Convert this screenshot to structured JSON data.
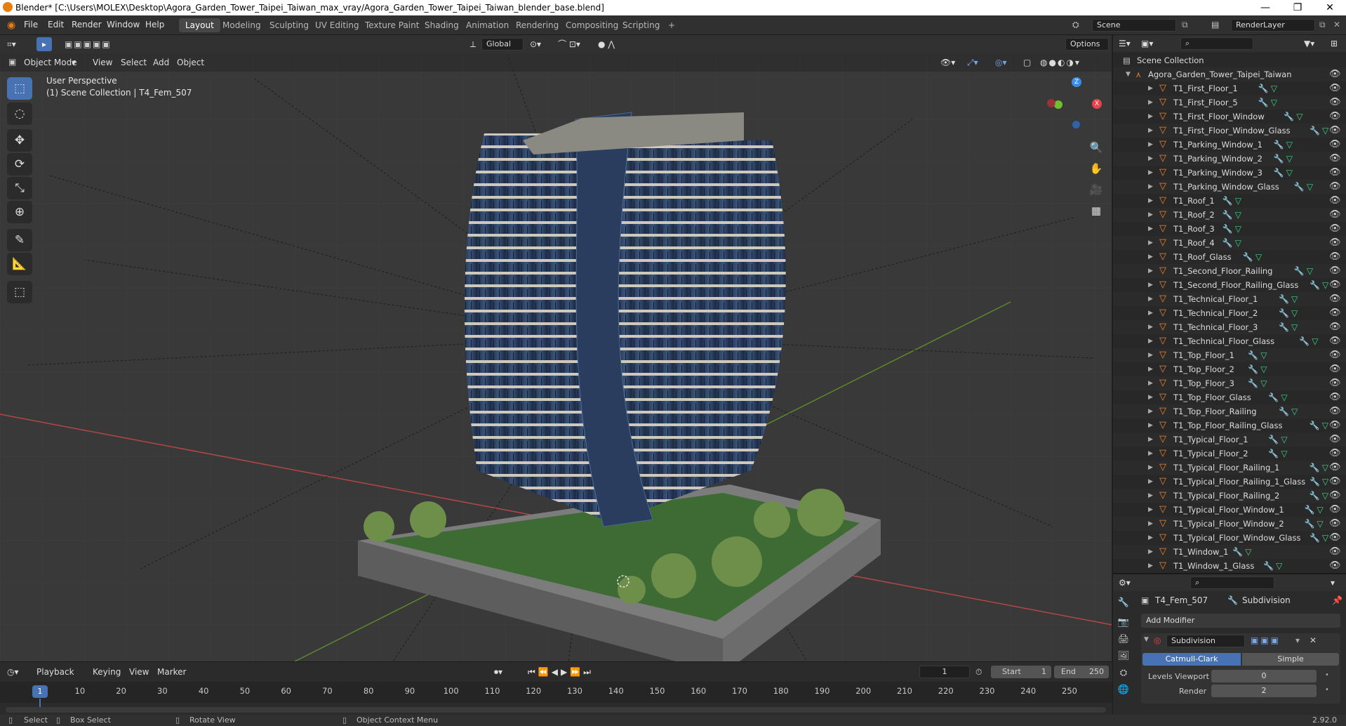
{
  "titlebar": {
    "title": "Blender* [C:\\Users\\MOLEX\\Desktop\\Agora_Garden_Tower_Taipei_Taiwan_max_vray/Agora_Garden_Tower_Taipei_Taiwan_blender_base.blend]",
    "minimize": "—",
    "restore": "❐",
    "close": "✕"
  },
  "menubar": {
    "items": [
      "File",
      "Edit",
      "Render",
      "Window",
      "Help"
    ]
  },
  "workspaces": {
    "tabs": [
      "Layout",
      "Modeling",
      "Sculpting",
      "UV Editing",
      "Texture Paint",
      "Shading",
      "Animation",
      "Rendering",
      "Compositing",
      "Scripting"
    ],
    "active": "Layout",
    "add": "+"
  },
  "scene": {
    "label": "Scene",
    "view_layer": "RenderLayer"
  },
  "viewport": {
    "mode": "Object Mode",
    "menus": [
      "View",
      "Select",
      "Add",
      "Object"
    ],
    "transform_orientation": "Global",
    "options": "Options",
    "overlay_line1": "User Perspective",
    "overlay_line2": "(1) Scene Collection | T4_Fem_507",
    "gizmo_axes": {
      "z": "Z",
      "x": "X",
      "y": "Y"
    }
  },
  "outliner": {
    "root": "Scene Collection",
    "collection": "Agora_Garden_Tower_Taipei_Taiwan",
    "items": [
      "T1_First_Floor_1",
      "T1_First_Floor_5",
      "T1_First_Floor_Window",
      "T1_First_Floor_Window_Glass",
      "T1_Parking_Window_1",
      "T1_Parking_Window_2",
      "T1_Parking_Window_3",
      "T1_Parking_Window_Glass",
      "T1_Roof_1",
      "T1_Roof_2",
      "T1_Roof_3",
      "T1_Roof_4",
      "T1_Roof_Glass",
      "T1_Second_Floor_Railing",
      "T1_Second_Floor_Railing_Glass",
      "T1_Technical_Floor_1",
      "T1_Technical_Floor_2",
      "T1_Technical_Floor_3",
      "T1_Technical_Floor_Glass",
      "T1_Top_Floor_1",
      "T1_Top_Floor_2",
      "T1_Top_Floor_3",
      "T1_Top_Floor_Glass",
      "T1_Top_Floor_Railing",
      "T1_Top_Floor_Railing_Glass",
      "T1_Typical_Floor_1",
      "T1_Typical_Floor_2",
      "T1_Typical_Floor_Railing_1",
      "T1_Typical_Floor_Railing_1_Glass",
      "T1_Typical_Floor_Railing_2",
      "T1_Typical_Floor_Window_1",
      "T1_Typical_Floor_Window_2",
      "T1_Typical_Floor_Window_Glass",
      "T1_Window_1",
      "T1_Window_1_Glass"
    ]
  },
  "properties": {
    "object_name": "T4_Fem_507",
    "modifier_tab": "Subdivision",
    "add_modifier": "Add Modifier",
    "modifier_name": "Subdivision",
    "mode_a": "Catmull-Clark",
    "mode_b": "Simple",
    "levels_viewport_label": "Levels Viewport",
    "levels_viewport_value": "0",
    "render_label": "Render",
    "render_value": "2"
  },
  "timeline": {
    "menus": [
      "Playback",
      "Keying",
      "View",
      "Marker"
    ],
    "current_frame": "1",
    "start_label": "Start",
    "start_value": "1",
    "end_label": "End",
    "end_value": "250",
    "ticks": [
      "1",
      "10",
      "20",
      "30",
      "40",
      "50",
      "60",
      "70",
      "80",
      "90",
      "100",
      "110",
      "120",
      "130",
      "140",
      "150",
      "160",
      "170",
      "180",
      "190",
      "200",
      "210",
      "220",
      "230",
      "240",
      "250"
    ]
  },
  "statusbar": {
    "select": "Select",
    "box_select": "Box Select",
    "rotate_view": "Rotate View",
    "context_menu": "Object Context Menu",
    "version": "2.92.0"
  },
  "colors": {
    "accent": "#4772b3",
    "object_icon": "#f0872f",
    "modifier": "#7aa7e8",
    "mesh": "#44d089",
    "x_axis": "#e8424c",
    "y_axis": "#6ec02e",
    "z_axis": "#3b8ee6"
  }
}
